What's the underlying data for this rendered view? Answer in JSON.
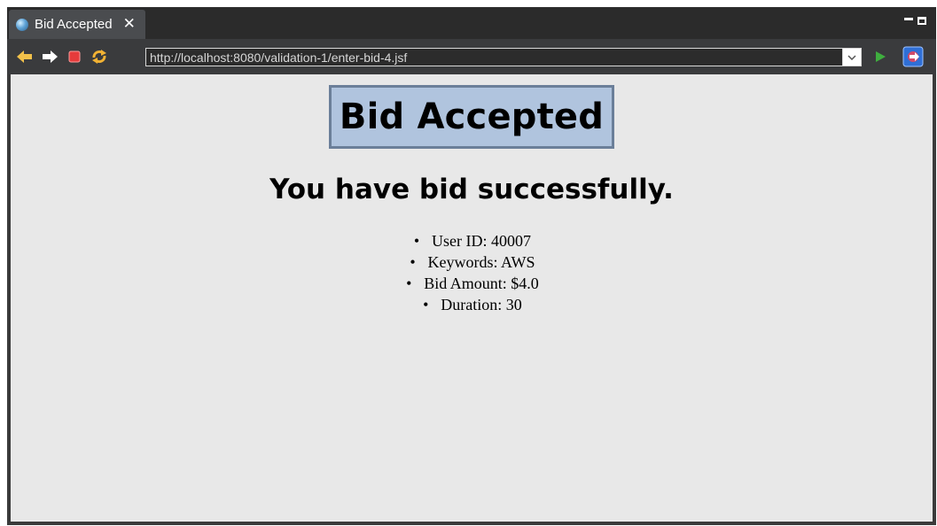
{
  "window": {
    "tab_title": "Bid Accepted",
    "tab_close": "✕"
  },
  "toolbar": {
    "url": "http://localhost:8080/validation-1/enter-bid-4.jsf"
  },
  "icons": {
    "back": "back-arrow-icon",
    "forward": "forward-arrow-icon",
    "stop": "stop-icon",
    "refresh": "refresh-icon",
    "go": "go-play-icon",
    "open_external": "open-external-browser-icon"
  },
  "page": {
    "heading": "Bid Accepted",
    "subheading": "You have bid successfully.",
    "details": [
      "User ID: 40007",
      "Keywords: AWS",
      "Bid Amount: $4.0",
      "Duration: 30"
    ]
  },
  "colors": {
    "heading_bg": "#b0c4de",
    "heading_border": "#6b7f99",
    "content_bg": "#e8e8e8",
    "chrome_dark": "#2b2b2b"
  }
}
